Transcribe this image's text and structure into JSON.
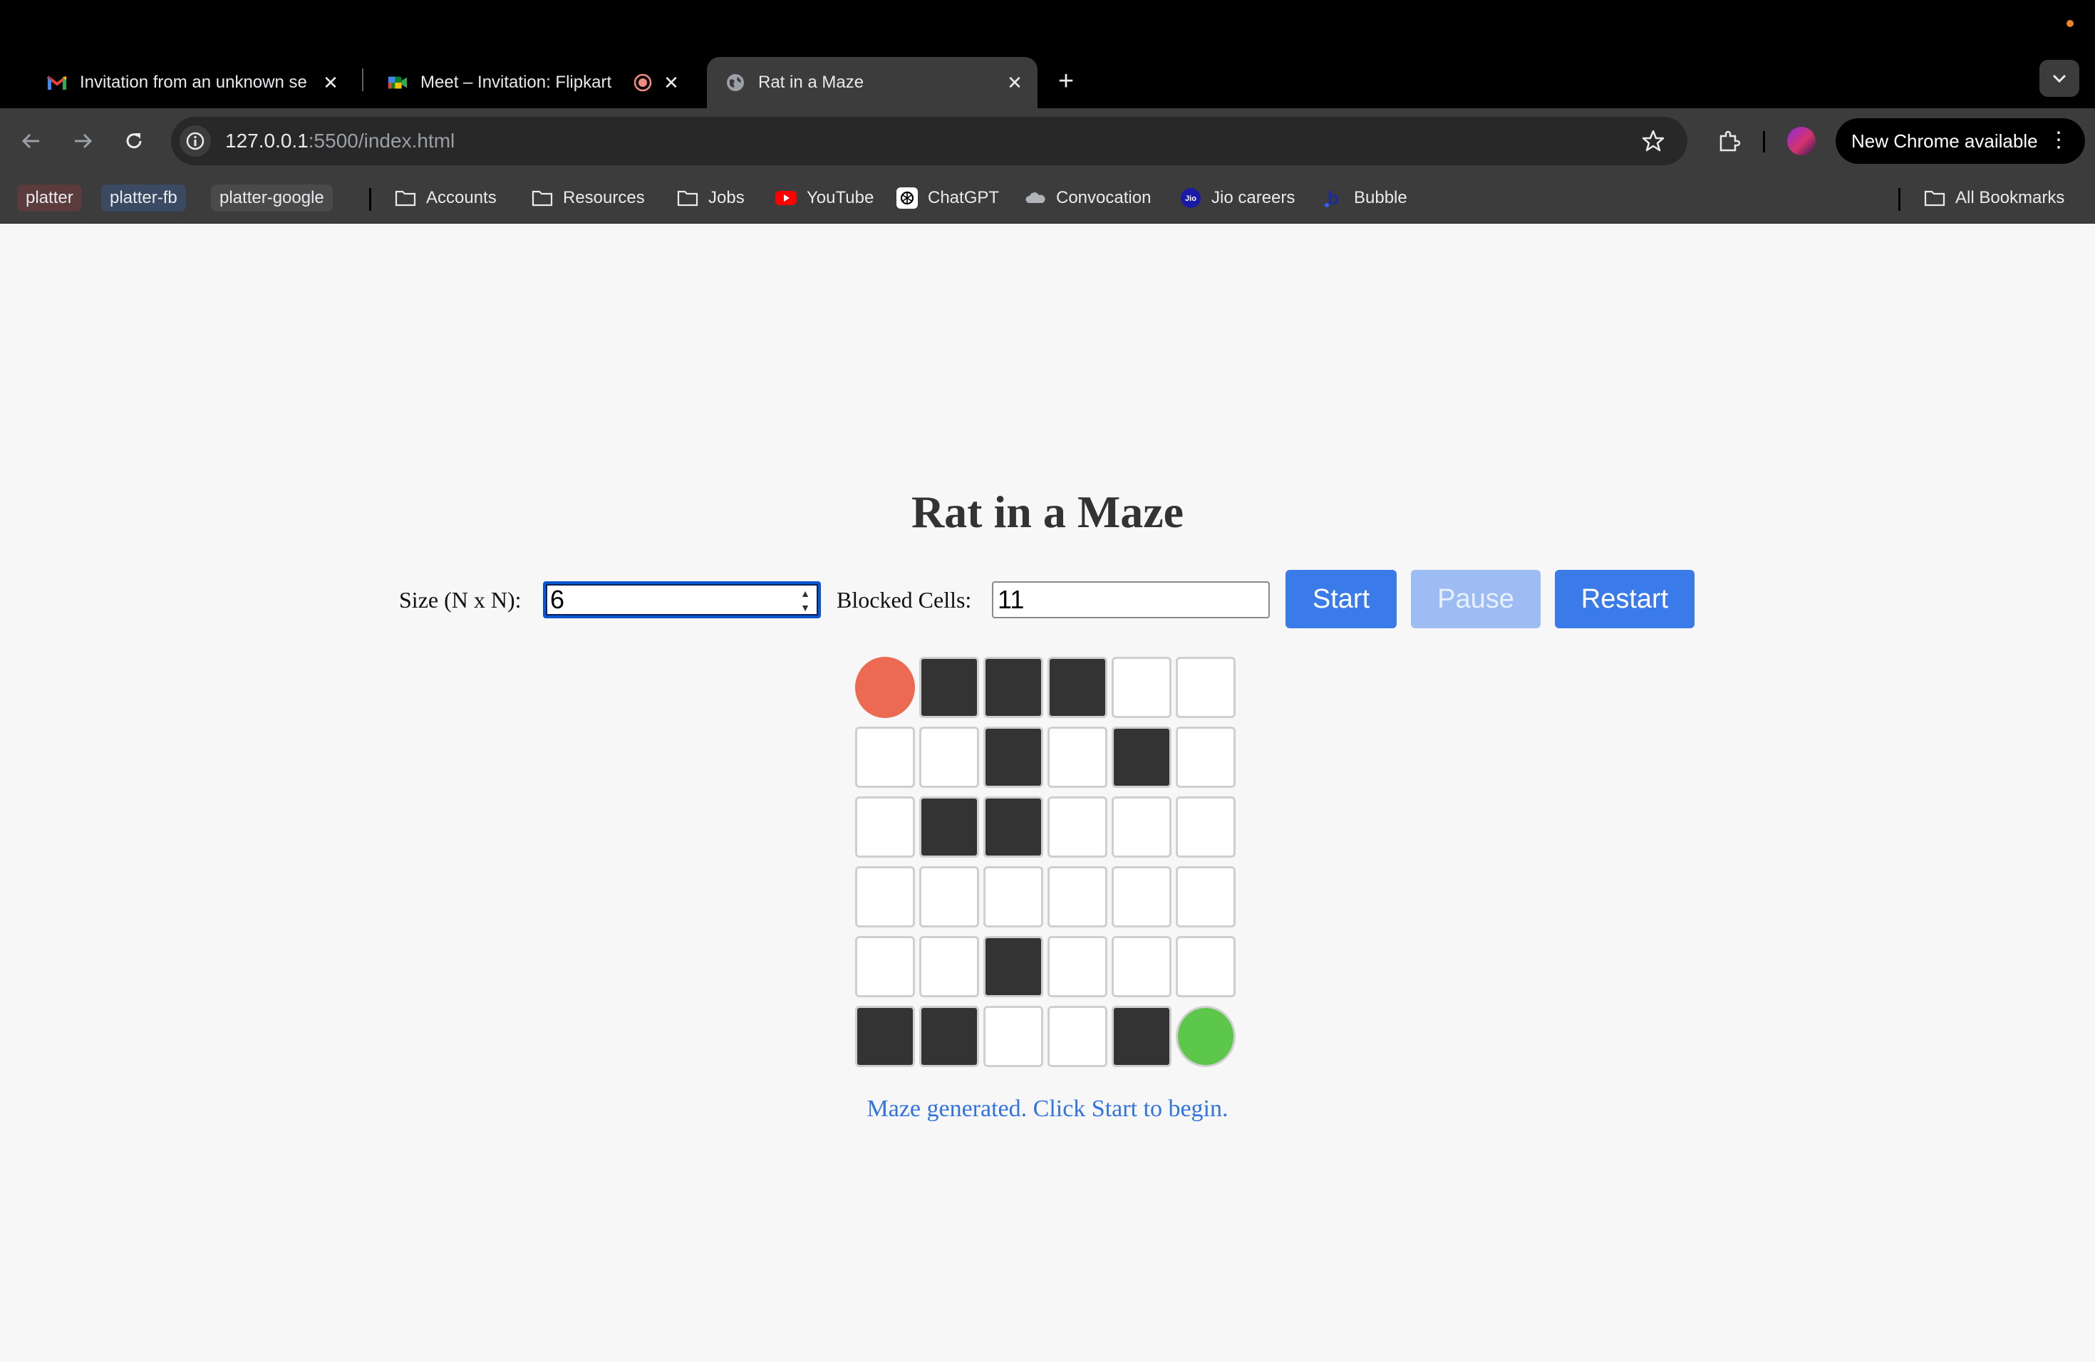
{
  "browser": {
    "tabs": [
      {
        "title": "Invitation from an unknown se",
        "icon": "gmail-icon",
        "active": false
      },
      {
        "title": "Meet – Invitation: Flipkart",
        "icon": "google-meet-icon",
        "active": false
      },
      {
        "title": "Rat in a Maze",
        "icon": "globe-icon",
        "active": true
      }
    ],
    "url_host": "127.0.0.1",
    "url_rest": ":5500/index.html",
    "update_label": "New Chrome available",
    "bookmarks": [
      {
        "label": "platter",
        "type": "chip",
        "color": "#5b3b3b"
      },
      {
        "label": "platter-fb",
        "type": "chip",
        "color": "#3b4a63"
      },
      {
        "label": "platter-google",
        "type": "chip",
        "color": "#4a4a4a"
      },
      {
        "label": "Accounts",
        "type": "folder"
      },
      {
        "label": "Resources",
        "type": "folder"
      },
      {
        "label": "Jobs",
        "type": "folder"
      },
      {
        "label": "YouTube",
        "type": "youtube"
      },
      {
        "label": "ChatGPT",
        "type": "chatgpt"
      },
      {
        "label": "Convocation",
        "type": "cloud"
      },
      {
        "label": "Jio careers",
        "type": "jio"
      },
      {
        "label": "Bubble",
        "type": "bubble"
      }
    ],
    "all_bookmarks": "All Bookmarks",
    "jio_badge": "Jio",
    "bubble_glyph": "b"
  },
  "page": {
    "title": "Rat in a Maze",
    "size_label": "Size (N x N):",
    "size_value": "6",
    "blocked_label": "Blocked Cells:",
    "blocked_value": "11",
    "start_label": "Start",
    "pause_label": "Pause",
    "restart_label": "Restart",
    "status": "Maze generated. Click Start to begin."
  },
  "maze": {
    "size": 6,
    "grid": [
      [
        "rat",
        "blocked",
        "blocked",
        "blocked",
        "open",
        "open"
      ],
      [
        "open",
        "open",
        "blocked",
        "open",
        "blocked",
        "open"
      ],
      [
        "open",
        "blocked",
        "blocked",
        "open",
        "open",
        "open"
      ],
      [
        "open",
        "open",
        "open",
        "open",
        "open",
        "open"
      ],
      [
        "open",
        "open",
        "blocked",
        "open",
        "open",
        "open"
      ],
      [
        "blocked",
        "blocked",
        "open",
        "open",
        "blocked",
        "goal"
      ]
    ],
    "colors": {
      "rat": "#ec6a52",
      "goal": "#5cc74b",
      "blocked": "#333333",
      "open": "#ffffff"
    }
  },
  "colors": {
    "accent": "#3b7be9",
    "status_text": "#2f74e0"
  }
}
